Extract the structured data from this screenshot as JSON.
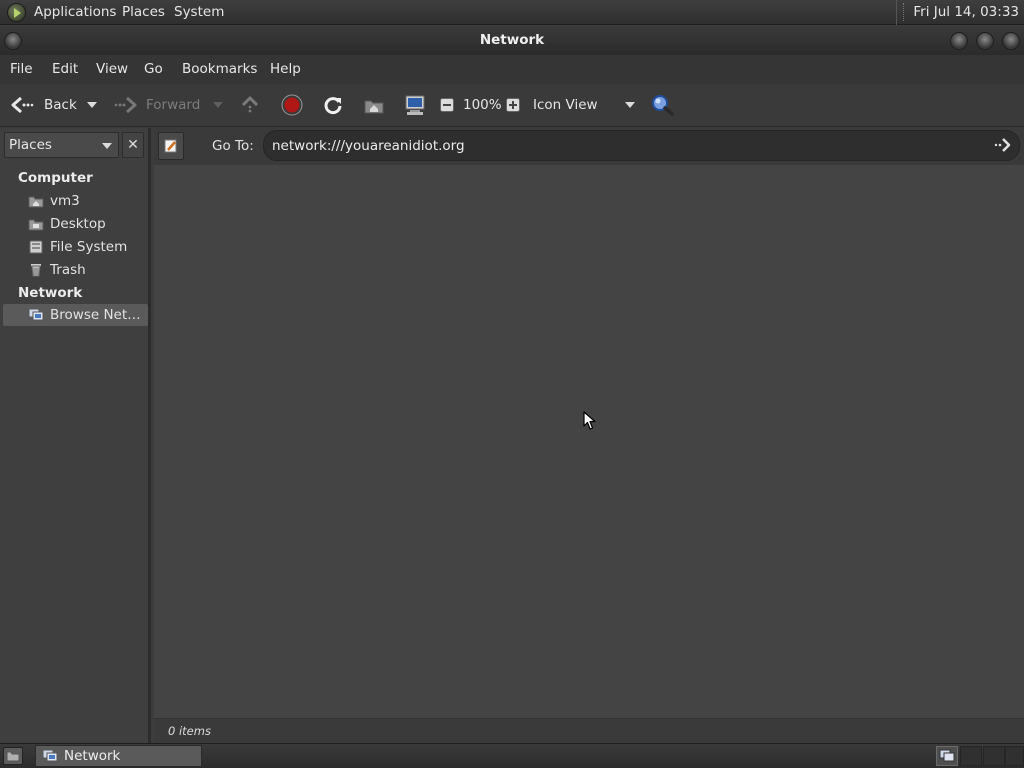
{
  "top_panel": {
    "menus": [
      "Applications",
      "Places",
      "System"
    ],
    "clock": "Fri Jul 14, 03:33"
  },
  "window": {
    "title": "Network"
  },
  "menubar": {
    "items": [
      "File",
      "Edit",
      "View",
      "Go",
      "Bookmarks",
      "Help"
    ]
  },
  "toolbar": {
    "back_label": "Back",
    "forward_label": "Forward",
    "zoom_level": "100%",
    "view_mode": "Icon View"
  },
  "sidebar": {
    "selector_label": "Places",
    "close_glyph": "✕",
    "sections": [
      {
        "title": "Computer",
        "items": [
          {
            "label": "vm3",
            "icon": "home-folder-icon"
          },
          {
            "label": "Desktop",
            "icon": "desktop-folder-icon"
          },
          {
            "label": "File System",
            "icon": "drive-icon"
          },
          {
            "label": "Trash",
            "icon": "trash-icon"
          }
        ]
      },
      {
        "title": "Network",
        "items": [
          {
            "label": "Browse Net…",
            "icon": "network-icon",
            "selected": true
          }
        ]
      }
    ]
  },
  "location_bar": {
    "label": "Go To:",
    "value": "network:///youareanidiot.org"
  },
  "status": {
    "text": "0 items"
  },
  "taskbar": {
    "tasks": [
      {
        "label": "Network",
        "icon": "network-icon"
      }
    ]
  },
  "colors": {
    "panel": "#2f2f2f",
    "content_bg": "#444444",
    "sidebar_bg": "#3f3f3f",
    "stop_red": "#b01818",
    "search_blue": "#3a6ec8"
  }
}
